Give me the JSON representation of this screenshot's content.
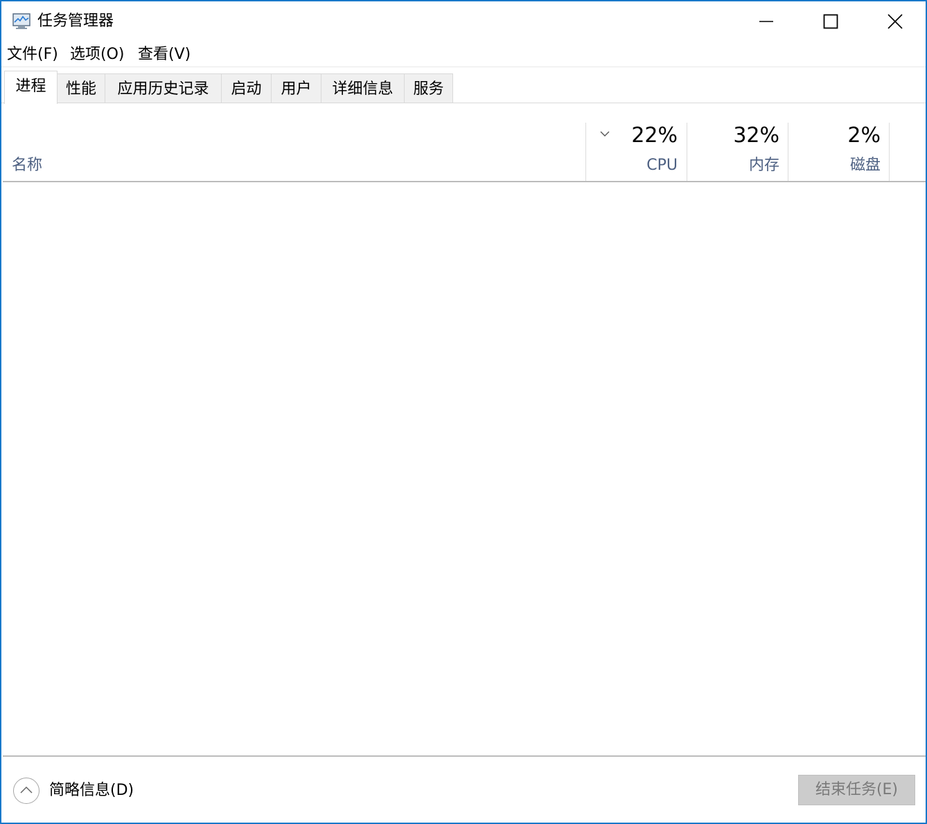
{
  "window": {
    "title": "任务管理器",
    "accent_color": "#1979ca",
    "icons": {
      "app": "task-manager-icon",
      "minimize": "minimize-icon",
      "maximize": "maximize-icon",
      "close": "close-icon"
    }
  },
  "menu": {
    "items": [
      "文件(F)",
      "选项(O)",
      "查看(V)"
    ]
  },
  "tabs": {
    "items": [
      "进程",
      "性能",
      "应用历史记录",
      "启动",
      "用户",
      "详细信息",
      "服务"
    ],
    "active": "进程"
  },
  "columns": {
    "name_label": "名称",
    "sort_icon": "chevron-down-icon",
    "cpu": {
      "percent": "22%",
      "label": "CPU"
    },
    "memory": {
      "percent": "32%",
      "label": "内存"
    },
    "disk": {
      "percent": "2%",
      "label": "磁盘"
    }
  },
  "processes": [],
  "footer": {
    "fewer_details_label": "简略信息(D)",
    "fewer_details_icon": "chevron-up-icon",
    "end_task_label": "结束任务(E)",
    "end_task_enabled": false
  }
}
